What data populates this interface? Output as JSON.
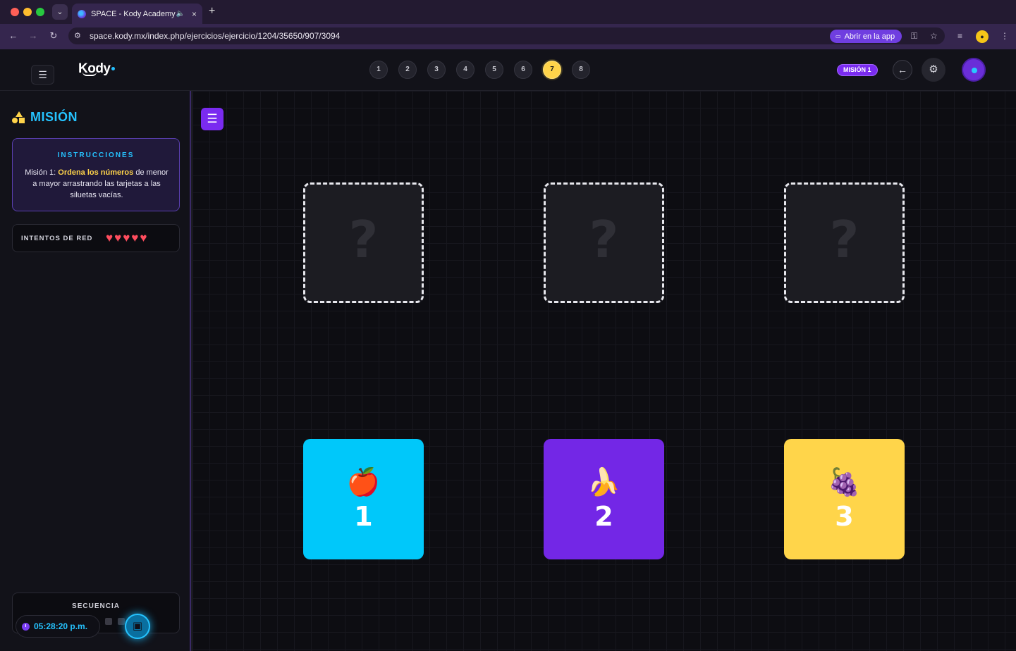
{
  "browser": {
    "tab_title": "SPACE - Kody Academy",
    "tab_close": "×",
    "new_tab": "+",
    "url": "space.kody.mx/index.php/ejercicios/ejercicio/1204/35650/907/3094",
    "open_app_label": "Abrir en la app"
  },
  "header": {
    "logo": "Kody",
    "steps": [
      "1",
      "2",
      "3",
      "4",
      "5",
      "6",
      "7",
      "8"
    ],
    "active_step": "7",
    "mission_badge": "MISIÓN 1",
    "back_icon": "←",
    "settings_icon": "⚙"
  },
  "sidebar": {
    "mission_title": "MISIÓN",
    "instructions_title": "INSTRUCCIONES",
    "instructions_prefix": "Misión 1: ",
    "instructions_highlight": "Ordena los números",
    "instructions_suffix": " de menor a mayor arrastrando las tarjetas a las siluetas vacías.",
    "attempts_label": "INTENTOS DE RED",
    "hearts": [
      "♥",
      "♥",
      "♥",
      "♥",
      "♥"
    ],
    "sequence_label": "SECUENCIA",
    "clock": "05:28:20 p.m."
  },
  "board": {
    "slots": [
      {
        "placeholder": "?"
      },
      {
        "placeholder": "?"
      },
      {
        "placeholder": "?"
      }
    ],
    "cards": [
      {
        "emoji": "🍎",
        "number": "1",
        "color": "#00c8fa"
      },
      {
        "emoji": "🍌",
        "number": "2",
        "color": "#7327e6"
      },
      {
        "emoji": "🍇",
        "number": "3",
        "color": "#ffd54a"
      }
    ]
  },
  "colors": {
    "accent_purple": "#7a2bf0",
    "accent_cyan": "#25c3ff",
    "accent_yellow": "#ffd44a",
    "heart": "#ff4d5e"
  }
}
